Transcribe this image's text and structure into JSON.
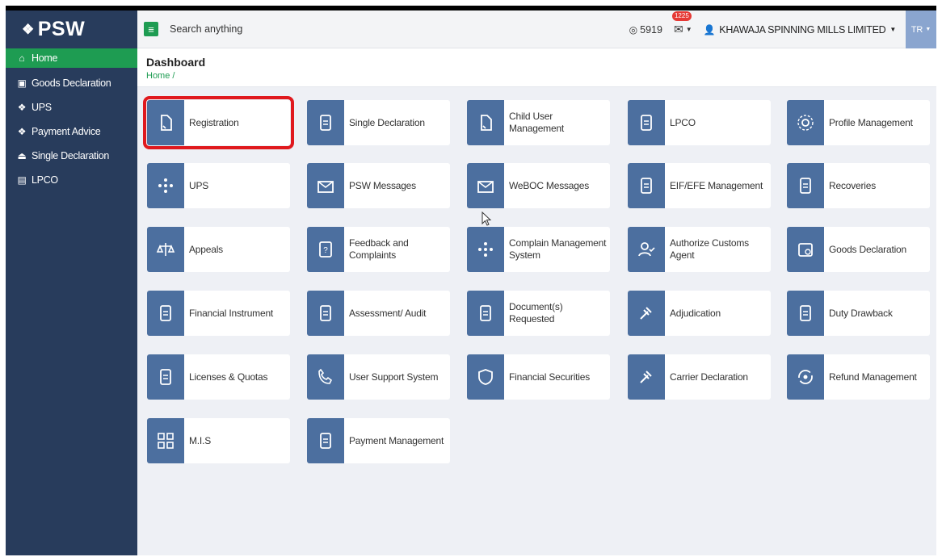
{
  "brand": {
    "logo_text": "PSW"
  },
  "sidebar": {
    "items": [
      {
        "label": "Home",
        "icon": "home-icon",
        "active": true
      },
      {
        "label": "Goods Declaration",
        "icon": "goods-declaration-icon"
      },
      {
        "label": "UPS",
        "icon": "ups-icon"
      },
      {
        "label": "Payment Advice",
        "icon": "payment-advice-icon"
      },
      {
        "label": "Single Declaration",
        "icon": "single-declaration-icon"
      },
      {
        "label": "LPCO",
        "icon": "lpco-icon"
      }
    ]
  },
  "header": {
    "search_placeholder": "Search anything",
    "counter": "5919",
    "mail_badge": "1225",
    "company": "KHAWAJA SPINNING MILLS LIMITED",
    "user_initials": "TR"
  },
  "page": {
    "title": "Dashboard",
    "breadcrumb": "Home /"
  },
  "tiles": [
    "Registration",
    "Single Declaration",
    "Child User Management",
    "LPCO",
    "Profile Management",
    "UPS",
    "PSW Messages",
    "WeBOC Messages",
    "EIF/EFE Management",
    "Recoveries",
    "Appeals",
    "Feedback and Complaints",
    "Complain Management System",
    "Authorize Customs Agent",
    "Goods Declaration",
    "Financial Instrument",
    "Assessment/ Audit",
    "Document(s) Requested",
    "Adjudication",
    "Duty Drawback",
    "Licenses & Quotas",
    "User Support System",
    "Financial Securities",
    "Carrier Declaration",
    "Refund Management",
    "M.I.S",
    "Payment Management"
  ],
  "colors": {
    "sidebar": "#283c5c",
    "accent": "#1e9c52",
    "tile_icon": "#4c6f9f",
    "highlight": "#e0191e"
  }
}
